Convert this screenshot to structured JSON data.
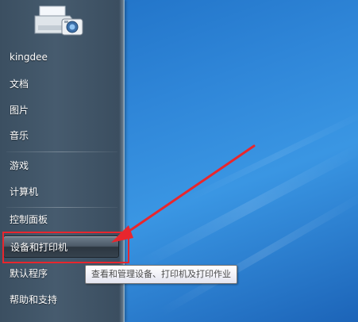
{
  "start_menu": {
    "username": "kingdee",
    "items": [
      {
        "label": "文档"
      },
      {
        "label": "图片"
      },
      {
        "label": "音乐"
      },
      {
        "label": "游戏"
      },
      {
        "label": "计算机"
      },
      {
        "label": "控制面板"
      },
      {
        "label": "设备和打印机"
      },
      {
        "label": "默认程序"
      },
      {
        "label": "帮助和支持"
      }
    ],
    "highlighted_item": "设备和打印机"
  },
  "tooltip": {
    "text": "查看和管理设备、打印机及打印作业"
  },
  "colors": {
    "annotation": "#e8262d",
    "desktop": "#2f86d8",
    "menu_pane": "#465b6e"
  },
  "icons": {
    "user_picture": "printer-camera-icon"
  }
}
